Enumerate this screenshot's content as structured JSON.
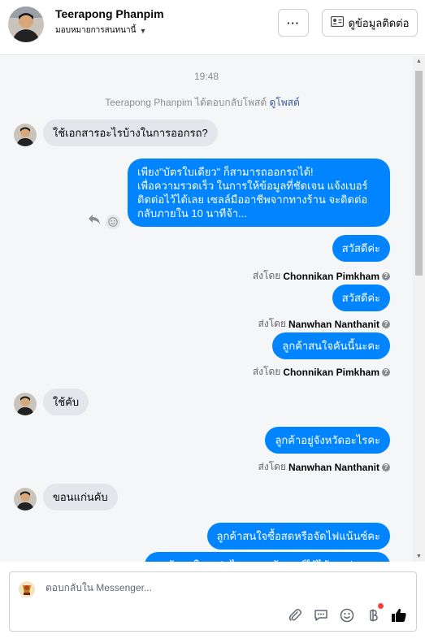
{
  "header": {
    "name": "Teerapong Phanpim",
    "assign_label": "มอบหมายการสนทนานี้",
    "more_label": "···",
    "contact_label": "ดูข้อมูลติดต่อ"
  },
  "chat": {
    "time": "19:48",
    "reply_note": "Teerapong Phanpim ได้ตอบกลับโพสต์",
    "view_post": "ดูโพสต์",
    "msg1": "ใช้เอกสารอะไรบ้างในการออกรถ?",
    "out1": "เพียง\"บัตรใบเดียว\" ก็สามารถออกรถได้!\nเพื่อความรวดเร็ว ในการให้ข้อมูลที่ชัดเจน แจ้งเบอร์ติดต่อไว้ได้เลย เซลล์มืออาชีพจากทางร้าน จะติดต่อกลับภายใน 10 นาทีจ้า...",
    "out2": "สวัสดีค่ะ",
    "sent_prefix": "ส่งโดย",
    "sender_a": "Chonnikan Pimkham",
    "out3": "สวัสดีค่ะ",
    "sender_b": "Nanwhan Nanthanit",
    "out4": "ลูกค้าสนใจคันนี้นะคะ",
    "sender_c": "Chonnikan Pimkham",
    "msg2": "ใช้คับ",
    "out5": "ลูกค้าอยู่จังหวัดอะไรคะ",
    "sender_d": "Nanwhan Nanthanit",
    "msg3": "ขอนแก่นคับ",
    "out6": "ลูกค้าสนใจซื้อสดหรือจัดไฟแน้นซ์คะ",
    "out7": "ลูกค้าสนใจรถรุ่นไหนคะ แจ้งเบอร์ไว้ได้เลยค่ะ"
  },
  "composer": {
    "placeholder": "ตอบกลับใน Messenger..."
  },
  "icons": {
    "more": "more-icon",
    "contact": "contact-card-icon",
    "reply": "reply-icon",
    "emoji": "emoji-icon",
    "attach": "paperclip-icon",
    "saved_reply": "chat-bubble-icon",
    "baht": "baht-icon",
    "like": "thumbs-up-icon",
    "info": "question-icon"
  },
  "colors": {
    "accent": "#0084ff",
    "incoming": "#e4e6eb",
    "like": "#050505"
  }
}
